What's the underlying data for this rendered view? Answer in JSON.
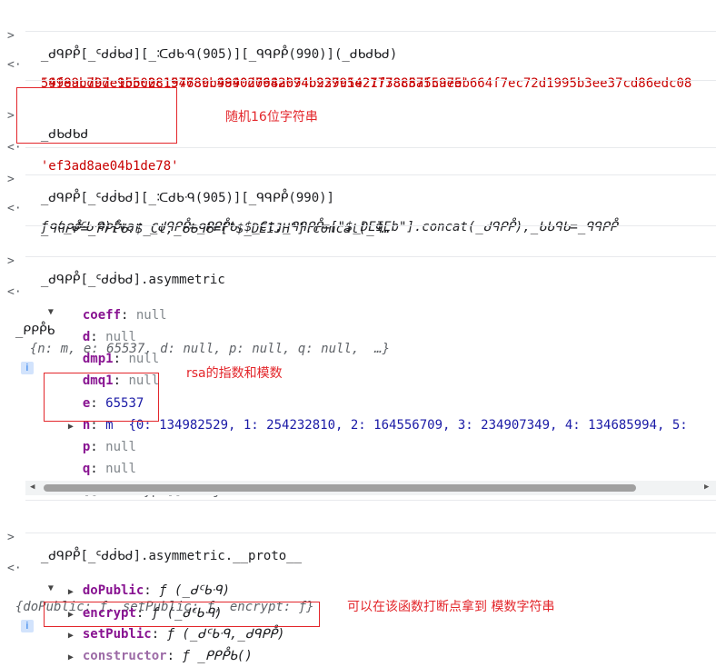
{
  "console": {
    "in_arrow": ">",
    "out_arrow": "<·",
    "line1_cmd": "_ᑯᑫᑭᑬ[_ᑦᑯᑰᑲᑯ][_ᑥᑯᑲᑴ(905)][_ᑫᑫᑭᑬ(990)](_ᑯᑲᑯᑲᑯ)",
    "line1_result": "'998acd97e9b500819778cb4840d0642b74b927c5e21778c57fcaeeb664f7ec72d1995b3ee37cd86edc08",
    "line1_result_cont": "54fe9b7bde15bc2c154689c99902798a094b23991427f3888a55975'",
    "line2_cmd": "_ᑯᑲᑯᑲᑯ",
    "line2_result": "'ef3ad8ae04b1de78'",
    "line3_cmd": "_ᑯᑫᑭᑬ[_ᑦᑯᑰᑲᑯ][_ᑥᑯᑲᑴ(905)][_ᑫᑫᑭᑬ(990)]",
    "line3_result_a": "ƒ (_ᑯᑦᑲᑴ){var _ᑯᑫᑭᑬ=_ᑭᑭᑬᑲ.$_Ct,_ᑫᑫᑭᑬ=[\"$_DEIEb\"].concat(_ᑯᑫᑭᑬ),_ᑲᑲᑫᑲ=_ᑫᑫᑭᑬ",
    "line3_result_b": "_ᑫᑫᑭᑬ=_ᑭᑭᑬᑲ.$_Ct,_ᑲᑲᑫᑲ=[\"$_DEIJH\"].concat(_ᑫ…",
    "line4_cmd": "_ᑯᑫᑭᑬ[_ᑦᑯᑰᑲᑯ].asymmetric",
    "obj_name": "_ᑭᑭᑬᑲ",
    "obj_summary": "{n: m, e: 65537, d: null, p: null, q: null,  …}",
    "props": [
      {
        "key": "coeff",
        "val": "null"
      },
      {
        "key": "d",
        "val": "null"
      },
      {
        "key": "dmp1",
        "val": "null"
      },
      {
        "key": "dmq1",
        "val": "null"
      },
      {
        "key": "e",
        "val": "65537"
      },
      {
        "key": "n",
        "val": "m  {0: 134982529, 1: 254232810, 2: 164556709, 3: 234907349, 4: 134685994, 5: "
      },
      {
        "key": "p",
        "val": "null"
      },
      {
        "key": "q",
        "val": "null"
      }
    ],
    "prototype_label": "[[Prototype]]: Object",
    "line5_cmd": "_ᑯᑫᑭᑬ[_ᑦᑯᑰᑲᑯ].asymmetric.__proto__",
    "proto_summary": "{doPublic: ƒ, setPublic: ƒ, encrypt: ƒ}",
    "proto_items": [
      {
        "key": "doPublic",
        "val": "ƒ (_ᑯᑦᑲᑴ)"
      },
      {
        "key": "encrypt",
        "val": "ƒ (_ᑯᑦᑲᑴ)"
      },
      {
        "key": "setPublic",
        "val": "ƒ (_ᑯᑦᑲᑴ,_ᑯᑫᑭᑬ)"
      },
      {
        "key": "constructor",
        "val": "ƒ _ᑭᑭᑬᑲ()"
      }
    ],
    "info_glyph": "i"
  },
  "annotations": {
    "random16": "随机16位字符串",
    "rsa": "rsa的指数和模数",
    "breakpoint": "可以在该函数打断点拿到 模数字符串"
  }
}
